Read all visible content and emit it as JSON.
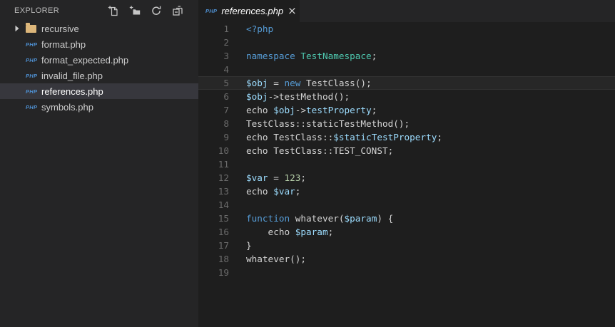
{
  "sidebar": {
    "title": "EXPLORER",
    "actions": [
      {
        "icon": "new-file-icon",
        "name": "new-file-button"
      },
      {
        "icon": "new-folder-icon",
        "name": "new-folder-button"
      },
      {
        "icon": "refresh-icon",
        "name": "refresh-explorer-button"
      },
      {
        "icon": "collapse-all-icon",
        "name": "collapse-folders-button"
      }
    ],
    "files": [
      {
        "label": "recursive",
        "type": "folder",
        "expandable": true,
        "selected": false
      },
      {
        "label": "format.php",
        "type": "php",
        "expandable": false,
        "selected": false
      },
      {
        "label": "format_expected.php",
        "type": "php",
        "expandable": false,
        "selected": false
      },
      {
        "label": "invalid_file.php",
        "type": "php",
        "expandable": false,
        "selected": false
      },
      {
        "label": "references.php",
        "type": "php",
        "expandable": false,
        "selected": true
      },
      {
        "label": "symbols.php",
        "type": "php",
        "expandable": false,
        "selected": false
      }
    ]
  },
  "tab": {
    "label": "references.php",
    "file_icon": "PHP",
    "close_glyph": "×",
    "preview_italic": true
  },
  "editor": {
    "php_icon_text": "PHP",
    "current_line": 5,
    "colors": {
      "background": "#1e1e1e",
      "sidebar_background": "#252526",
      "selection_row": "#37373d",
      "keyword": "#569cd6",
      "class_name": "#4ec9b0",
      "variable": "#9cdcfe",
      "number": "#b5cea8",
      "default_text": "#d4d4d4",
      "line_number": "#6b6b6b",
      "php_icon": "#4e8fd0",
      "folder_icon": "#dcb67a"
    },
    "lines": [
      {
        "num": 1,
        "tokens": [
          [
            "kw",
            "<?php"
          ]
        ]
      },
      {
        "num": 2,
        "tokens": []
      },
      {
        "num": 3,
        "tokens": [
          [
            "kw",
            "namespace"
          ],
          [
            "def",
            " "
          ],
          [
            "cls",
            "TestNamespace"
          ],
          [
            "def",
            ";"
          ]
        ]
      },
      {
        "num": 4,
        "tokens": []
      },
      {
        "num": 5,
        "tokens": [
          [
            "var",
            "$obj"
          ],
          [
            "def",
            " = "
          ],
          [
            "kw",
            "new"
          ],
          [
            "def",
            " TestClass();"
          ]
        ]
      },
      {
        "num": 6,
        "tokens": [
          [
            "var",
            "$obj"
          ],
          [
            "def",
            "->testMethod();"
          ]
        ]
      },
      {
        "num": 7,
        "tokens": [
          [
            "def",
            "echo "
          ],
          [
            "var",
            "$obj"
          ],
          [
            "def",
            "->"
          ],
          [
            "var",
            "testProperty"
          ],
          [
            "def",
            ";"
          ]
        ]
      },
      {
        "num": 8,
        "tokens": [
          [
            "def",
            "TestClass::staticTestMethod();"
          ]
        ]
      },
      {
        "num": 9,
        "tokens": [
          [
            "def",
            "echo TestClass::"
          ],
          [
            "var",
            "$staticTestProperty"
          ],
          [
            "def",
            ";"
          ]
        ]
      },
      {
        "num": 10,
        "tokens": [
          [
            "def",
            "echo TestClass::TEST_CONST;"
          ]
        ]
      },
      {
        "num": 11,
        "tokens": []
      },
      {
        "num": 12,
        "tokens": [
          [
            "var",
            "$var"
          ],
          [
            "def",
            " = "
          ],
          [
            "num",
            "123"
          ],
          [
            "def",
            ";"
          ]
        ]
      },
      {
        "num": 13,
        "tokens": [
          [
            "def",
            "echo "
          ],
          [
            "var",
            "$var"
          ],
          [
            "def",
            ";"
          ]
        ]
      },
      {
        "num": 14,
        "tokens": []
      },
      {
        "num": 15,
        "tokens": [
          [
            "kw",
            "function"
          ],
          [
            "def",
            " whatever("
          ],
          [
            "var",
            "$param"
          ],
          [
            "def",
            ") {"
          ]
        ]
      },
      {
        "num": 16,
        "tokens": [
          [
            "def",
            "    echo "
          ],
          [
            "var",
            "$param"
          ],
          [
            "def",
            ";"
          ]
        ]
      },
      {
        "num": 17,
        "tokens": [
          [
            "def",
            "}"
          ]
        ]
      },
      {
        "num": 18,
        "tokens": [
          [
            "def",
            "whatever();"
          ]
        ]
      },
      {
        "num": 19,
        "tokens": []
      }
    ]
  }
}
